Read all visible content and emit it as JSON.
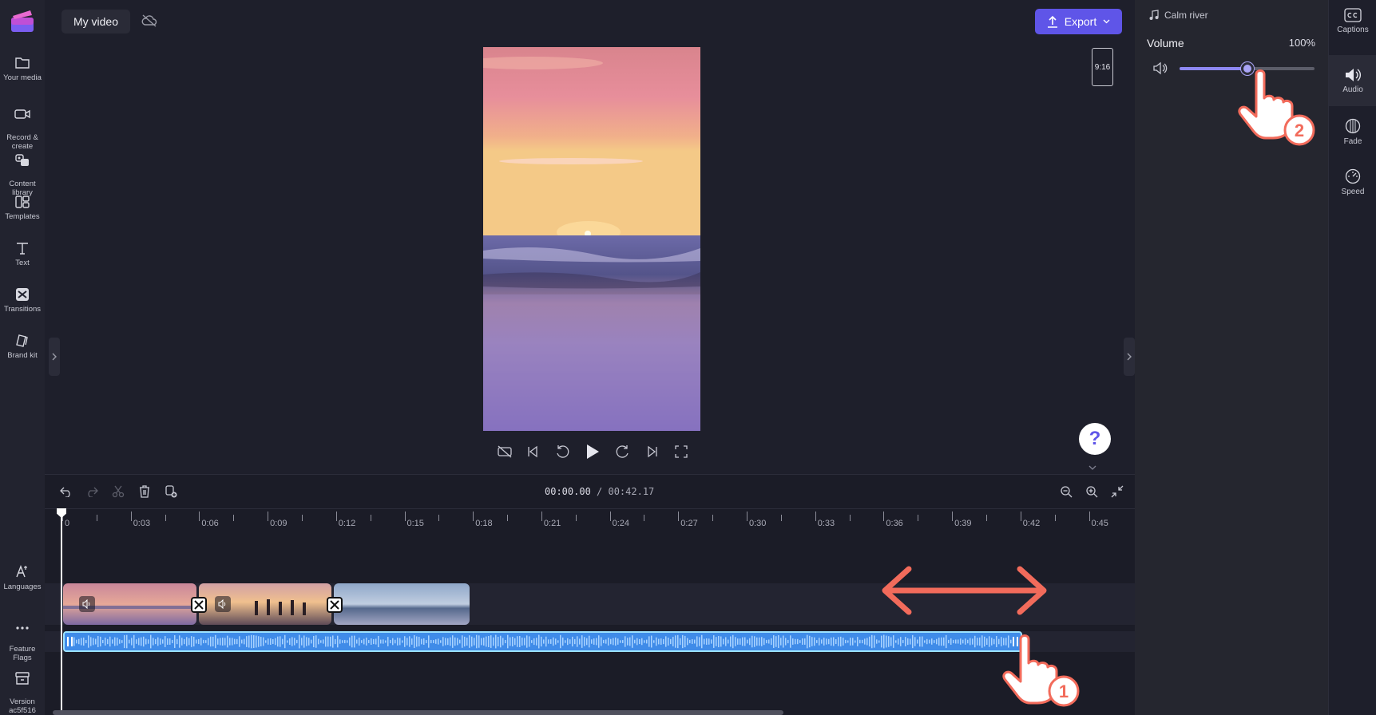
{
  "leftnav": {
    "items": [
      {
        "label": "Your media",
        "icon": "folder-icon"
      },
      {
        "label": "Record &\ncreate",
        "icon": "camera-icon"
      },
      {
        "label": "Content\nlibrary",
        "icon": "library-icon"
      },
      {
        "label": "Templates",
        "icon": "templates-icon"
      },
      {
        "label": "Text",
        "icon": "text-icon"
      },
      {
        "label": "Transitions",
        "icon": "transitions-icon"
      },
      {
        "label": "Brand kit",
        "icon": "brand-kit-icon"
      }
    ],
    "bottom_items": [
      {
        "label": "Languages",
        "icon": "languages-icon"
      },
      {
        "label": "Feature\nFlags",
        "icon": "more-icon"
      },
      {
        "label": "Version\nac5f516",
        "icon": "version-icon"
      }
    ]
  },
  "topbar": {
    "project_title": "My video",
    "export_label": "Export"
  },
  "preview": {
    "aspect_ratio": "9:16"
  },
  "help": {
    "label": "?"
  },
  "timeline": {
    "current_time": "00:00.00",
    "separator": " / ",
    "total_time": "00:42.17",
    "ticks": [
      "0",
      "0:03",
      "0:06",
      "0:09",
      "0:12",
      "0:15",
      "0:18",
      "0:21",
      "0:24",
      "0:27",
      "0:30",
      "0:33",
      "0:36",
      "0:39",
      "0:42",
      "0:45"
    ]
  },
  "properties": {
    "asset_name": "Calm river",
    "volume_label": "Volume",
    "volume_value": "100%",
    "volume_level_percent": 50
  },
  "rail": {
    "items": [
      {
        "label": "Captions",
        "icon": "captions-icon"
      },
      {
        "label": "Audio",
        "icon": "audio-icon"
      },
      {
        "label": "Fade",
        "icon": "fade-icon"
      },
      {
        "label": "Speed",
        "icon": "speed-icon"
      }
    ]
  },
  "annotations": {
    "step1": "1",
    "step2": "2"
  },
  "colors": {
    "accent": "#5f55e8",
    "audio_clip": "#3f8be8",
    "annotation": "#f26b5b"
  }
}
